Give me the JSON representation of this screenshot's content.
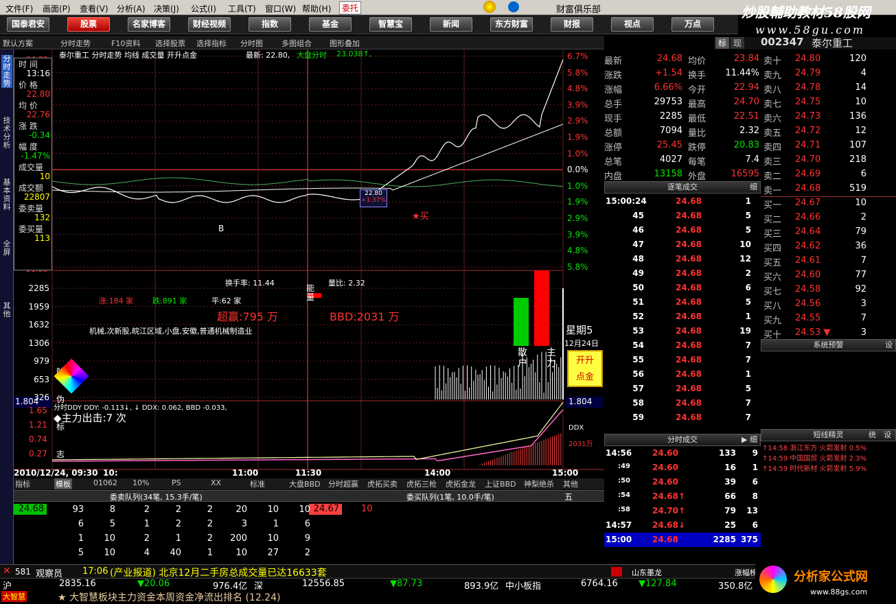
{
  "menu": {
    "items": [
      "文件(F)",
      "画面(P)",
      "查看(V)",
      "分析(A)",
      "决策(J)",
      "公式(I)",
      "工具(T)",
      "窗口(W)",
      "帮助(H)"
    ],
    "active": "委托"
  },
  "brand": {
    "text": "财富俱乐部",
    "watermark1": "炒股輔助教材58股网",
    "watermark2": "www.58gu.com"
  },
  "nav": [
    "国泰君安",
    "股票",
    "名家博客",
    "财经视频",
    "指数",
    "基金",
    "智慧宝",
    "新闻",
    "东方财富",
    "财报",
    "视点",
    "万点"
  ],
  "toolbar": [
    "默认方案",
    "分时走势",
    "F10资料",
    "选择股票",
    "选择指标",
    "分时图",
    "多图组合",
    "图形叠加"
  ],
  "side_tabs": [
    "分时走势",
    "技术分析",
    "基本资料",
    "全屏",
    "其他"
  ],
  "chart": {
    "header": "泰尔重工  分时走势 均线 成交量 开升点金",
    "latest_label": "最新: 22.80,",
    "index_label": "大盘分时",
    "index_value": "23.038↑,",
    "top_price": "24.70",
    "pct_labels": [
      "6.7%",
      "5.8%",
      "4.8%",
      "3.9%",
      "2.9%",
      "1.9%",
      "1.0%",
      "0.0%",
      "1.0%",
      "1.9%",
      "2.9%",
      "3.9%",
      "4.8%",
      "5.8%"
    ],
    "vol_labels": [
      "2285",
      "1959",
      "1632",
      "1306",
      "979",
      "653",
      "326"
    ],
    "vol_top": "21.80",
    "ind_labels": [
      "1.65",
      "1.21",
      "0.74",
      "0.27"
    ],
    "ind_top": "1.804",
    "times": [
      "2010/12/24, 09:30",
      "10:",
      "11:00",
      "11:30",
      "14:00",
      "15:00"
    ],
    "info_texts": {
      "turnover": "换手率: 11.44",
      "ratio": "量比: 2.32",
      "up": "涨:184 家",
      "down": "跌:891 家",
      "flat": "平:62 家",
      "profit": "超赢:795 万",
      "bbd": "BBD:2031 万",
      "sectors": "机械,次新股,皖江区域,小盘,安徽,普通机械制造业",
      "weekday": "星期5",
      "date": "12月24日",
      "btn": "开升点金",
      "neng": "能量",
      "sanhu": "散户",
      "zhuli": "主力",
      "anti": "防伪标志",
      "buy_mark": "★买",
      "b_mark": "B",
      "tooltip1": "22.80",
      "tooltip2": "+1.37%",
      "ddx_line": "分时DDY  DDY: -0.113↓,        ↓ DDX: 0.062, BBD -0.033,",
      "main_out": "◆主力出击:7 次",
      "ddx_r": "DDX",
      "ddx_v": "2031万",
      "vol_side": "1.804"
    }
  },
  "infobox": [
    {
      "l": "时 间",
      "v": "13:16",
      "c": "wht"
    },
    {
      "l": "价 格",
      "v": "22.80",
      "c": "red"
    },
    {
      "l": "均 价",
      "v": "22.76",
      "c": "red"
    },
    {
      "l": "涨 跌",
      "v": "-0.34",
      "c": "grn"
    },
    {
      "l": "幅 度",
      "v": "-1.47%",
      "c": "grn"
    },
    {
      "l": "成交量",
      "v": "10",
      "c": "yel"
    },
    {
      "l": "成交额",
      "v": "22807",
      "c": "yel"
    },
    {
      "l": "委卖量",
      "v": "132",
      "c": "yel"
    },
    {
      "l": "委买量",
      "v": "113",
      "c": "yel"
    }
  ],
  "stock": {
    "code": "002347",
    "name": "泰尔重工",
    "tab1": "标",
    "tab2": "现"
  },
  "quote": [
    [
      "最新",
      "24.68",
      "red",
      "均价",
      "23.84",
      "red"
    ],
    [
      "涨跌",
      "+1.54",
      "red",
      "换手",
      "11.44%",
      "wht"
    ],
    [
      "涨幅",
      "6.66%",
      "red",
      "今开",
      "22.94",
      "red"
    ],
    [
      "总手",
      "29753",
      "wht",
      "最高",
      "24.70",
      "red"
    ],
    [
      "现手",
      "2285",
      "wht",
      "最低",
      "22.51",
      "red"
    ],
    [
      "总额",
      "7094",
      "wht",
      "量比",
      "2.32",
      "wht"
    ],
    [
      "涨停",
      "25.45",
      "red",
      "跌停",
      "20.83",
      "grn"
    ],
    [
      "总笔",
      "4027",
      "wht",
      "每笔",
      "7.4",
      "wht"
    ],
    [
      "内盘",
      "13158",
      "grn",
      "外盘",
      "16595",
      "red"
    ]
  ],
  "asks": [
    [
      "卖十",
      "24.80",
      "120"
    ],
    [
      "卖九",
      "24.79",
      "4"
    ],
    [
      "卖八",
      "24.78",
      "14"
    ],
    [
      "卖七",
      "24.75",
      "10"
    ],
    [
      "卖六",
      "24.73",
      "136"
    ],
    [
      "卖五",
      "24.72",
      "12"
    ],
    [
      "卖四",
      "24.71",
      "107"
    ],
    [
      "卖三",
      "24.70",
      "218"
    ],
    [
      "卖二",
      "24.69",
      "6"
    ],
    [
      "卖一",
      "24.68",
      "519"
    ]
  ],
  "bids": [
    [
      "买一",
      "24.67",
      "10"
    ],
    [
      "买二",
      "24.66",
      "2"
    ],
    [
      "买三",
      "24.64",
      "79"
    ],
    [
      "买四",
      "24.62",
      "36"
    ],
    [
      "买五",
      "24.61",
      "7"
    ],
    [
      "买六",
      "24.60",
      "77"
    ],
    [
      "买七",
      "24.58",
      "92"
    ],
    [
      "买八",
      "24.56",
      "3"
    ],
    [
      "买九",
      "24.55",
      "7"
    ],
    [
      "买十",
      "24.53 ▼",
      "3"
    ]
  ],
  "ticks_header": "逐笔成交",
  "ticks": [
    [
      "15:00:24",
      "24.68",
      "1"
    ],
    [
      "45",
      "24.68",
      "5"
    ],
    [
      "46",
      "24.68",
      "5"
    ],
    [
      "47",
      "24.68",
      "10"
    ],
    [
      "48",
      "24.68",
      "12"
    ],
    [
      "49",
      "24.68",
      "2"
    ],
    [
      "50",
      "24.68",
      "6"
    ],
    [
      "51",
      "24.68",
      "5"
    ],
    [
      "52",
      "24.68",
      "1"
    ],
    [
      "53",
      "24.68",
      "19"
    ],
    [
      "54",
      "24.68",
      "7"
    ],
    [
      "55",
      "24.68",
      "7"
    ],
    [
      "56",
      "24.68",
      "1"
    ],
    [
      "57",
      "24.68",
      "5"
    ],
    [
      "58",
      "24.68",
      "7"
    ],
    [
      "59",
      "24.68",
      "7"
    ]
  ],
  "ticks2_header": "分时成交",
  "ticks2": [
    [
      "14:56",
      "24.60",
      "133",
      "9"
    ],
    [
      ":49",
      "24.60",
      "16",
      "1"
    ],
    [
      ":50",
      "24.60",
      "39",
      "6"
    ],
    [
      ":54",
      "24.68↑",
      "66",
      "8"
    ],
    [
      ":58",
      "24.70↑",
      "79",
      "13"
    ],
    [
      "14:57",
      "24.68↓",
      "25",
      "6"
    ],
    [
      "15:00",
      "24.68",
      "2285",
      "375"
    ]
  ],
  "alerts_header": "系统预警",
  "short_header": "短线精灵",
  "short_tabs": [
    "统",
    "设"
  ],
  "alerts": [
    "↑14:58 浙江东方 火箭发射 0.5%",
    "↑14:59 中国国贸 火箭发射 2.3%",
    "↑14:59 时代新材 火箭发射 5.9%"
  ],
  "queue": {
    "tabs": [
      "指标",
      "模板",
      "01062",
      "10%",
      "PS",
      "XX",
      "标准",
      "大盘BBD",
      "分时超赢",
      "虎拓买卖",
      "虎拓三枪",
      "虎拓金龙",
      "上证BBD",
      "神梨绝杀",
      "其他"
    ],
    "sell_title": "委卖队列(34笔, 15.3手/笔)",
    "buy_title": "委买队列(1笔, 10.0手/笔)",
    "sell_price": "24.68",
    "buy_price": "24.67",
    "buy_qty": "10",
    "five": "五",
    "rows": [
      [
        "93",
        "8",
        "2",
        "2",
        "2",
        "20",
        "10",
        "10"
      ],
      [
        "6",
        "5",
        "1",
        "2",
        "2",
        "3",
        "1",
        "6"
      ],
      [
        "1",
        "10",
        "2",
        "1",
        "2",
        "200",
        "10",
        "9"
      ],
      [
        "5",
        "10",
        "4",
        "40",
        "1",
        "10",
        "27",
        "2"
      ]
    ]
  },
  "status": {
    "id": "581",
    "role": "观察员",
    "time": "17:06",
    "news": "(产业报道) 北京12月二手房总成交量已达16633套",
    "right1": "山东墨龙",
    "right2": "涨幅榜"
  },
  "indexbar": [
    {
      "t": "沪",
      "c": "wht"
    },
    {
      "t": "2835.16",
      "c": "wht"
    },
    {
      "t": "▼20.06",
      "c": "grn"
    },
    {
      "t": "976.4亿",
      "c": "wht"
    },
    {
      "t": "深",
      "c": "wht"
    },
    {
      "t": "12556.85",
      "c": "wht"
    },
    {
      "t": "▼87.73",
      "c": "grn"
    },
    {
      "t": "893.9亿",
      "c": "wht"
    },
    {
      "t": "中小板指",
      "c": "wht"
    },
    {
      "t": "6764.16",
      "c": "wht"
    },
    {
      "t": "▼127.84",
      "c": "grn"
    },
    {
      "t": "350.8亿",
      "c": "wht"
    }
  ],
  "newsbar": {
    "tag": "大智慧",
    "text": "★ 大智慧板块主力资金本周资金净流出排名 (12.24)"
  },
  "logo": {
    "cn": "分析家公式网",
    "url": "www.88gs.com"
  }
}
